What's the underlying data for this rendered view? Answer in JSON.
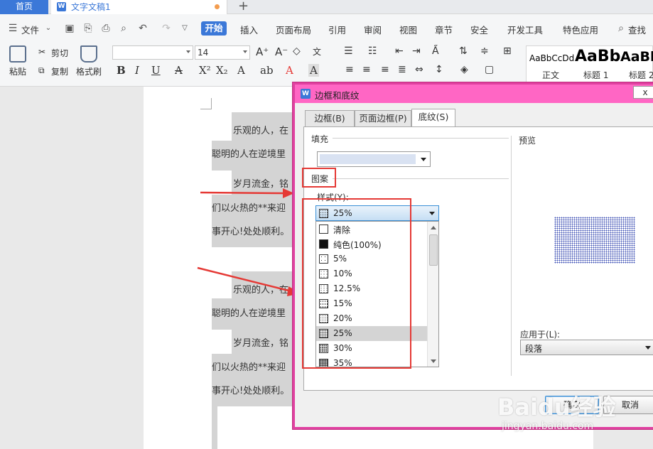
{
  "tabs": {
    "home": "首页",
    "doc": "文字文稿1"
  },
  "menu": {
    "file": "文件",
    "items": [
      "开始",
      "插入",
      "页面布局",
      "引用",
      "审阅",
      "视图",
      "章节",
      "安全",
      "开发工具",
      "特色应用"
    ],
    "search": "查找"
  },
  "ribbon": {
    "paste": "粘贴",
    "cut": "剪切",
    "copy": "复制",
    "format_painter": "格式刷",
    "font_size": "14",
    "styles": [
      {
        "sample": "AaBbCcDd",
        "name": "正文"
      },
      {
        "sample": "AaBb",
        "name": "标题 1"
      },
      {
        "sample": "AaBb",
        "name": "标题 2"
      }
    ]
  },
  "document": {
    "lines": [
      "乐观的人，在",
      "聪明的人在逆境里",
      "岁月流金，铭",
      "们以火热的**来迎",
      "事开心!处处顺利。",
      "乐观的人，在",
      "聪明的人在逆境里",
      "岁月流金，铭",
      "们以火热的**来迎",
      "事开心!处处顺利。"
    ]
  },
  "dialog": {
    "title": "边框和底纹",
    "close": "x",
    "tabs": [
      "边框(B)",
      "页面边框(P)",
      "底纹(S)"
    ],
    "fill_label": "填充",
    "fill_color": "#d9e2f2",
    "pattern_label": "图案",
    "style_label": "样式(Y):",
    "style_selected": "25%",
    "pattern_options": [
      "清除",
      "纯色(100%)",
      "5%",
      "10%",
      "12.5%",
      "15%",
      "20%",
      "25%",
      "30%",
      "35%"
    ],
    "selected_option": "25%",
    "preview_label": "预览",
    "apply_label": "应用于(L):",
    "apply_value": "段落",
    "ok": "确定",
    "cancel": "取消"
  },
  "watermark": {
    "main": "Baidu经验",
    "sub": "jingyan.baidu.com"
  },
  "colors": {
    "accent": "#3b78d8",
    "dialog_frame": "#ff66c4",
    "annotation": "#e53935"
  }
}
